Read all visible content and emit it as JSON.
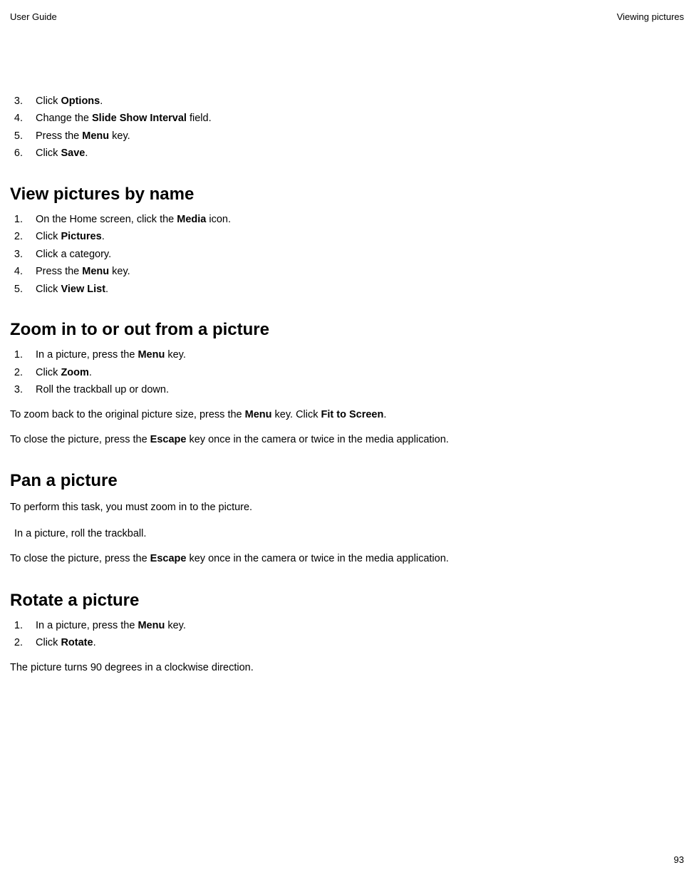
{
  "header": {
    "left": "User Guide",
    "right": "Viewing pictures"
  },
  "intro_list": [
    {
      "num": "3.",
      "pre": "Click ",
      "bold": "Options",
      "post": "."
    },
    {
      "num": "4.",
      "pre": "Change the ",
      "bold": "Slide Show Interval",
      "post": " field."
    },
    {
      "num": "5.",
      "pre": "Press the ",
      "bold": "Menu",
      "post": " key."
    },
    {
      "num": "6.",
      "pre": "Click ",
      "bold": "Save",
      "post": "."
    }
  ],
  "section1": {
    "title": "View pictures by name",
    "items": [
      {
        "num": "1.",
        "pre": "On the Home screen, click the ",
        "bold": "Media",
        "post": " icon."
      },
      {
        "num": "2.",
        "pre": "Click ",
        "bold": "Pictures",
        "post": "."
      },
      {
        "num": "3.",
        "pre": "Click a category.",
        "bold": "",
        "post": ""
      },
      {
        "num": "4.",
        "pre": "Press the ",
        "bold": "Menu",
        "post": " key."
      },
      {
        "num": "5.",
        "pre": "Click ",
        "bold": "View List",
        "post": "."
      }
    ]
  },
  "section2": {
    "title": "Zoom in to or out from a picture",
    "items": [
      {
        "num": "1.",
        "pre": "In a picture, press the ",
        "bold": "Menu",
        "post": " key."
      },
      {
        "num": "2.",
        "pre": "Click ",
        "bold": "Zoom",
        "post": "."
      },
      {
        "num": "3.",
        "pre": "Roll the trackball up or down.",
        "bold": "",
        "post": ""
      }
    ],
    "para1_pre": "To zoom back to the original picture size, press the ",
    "para1_b1": "Menu",
    "para1_mid": " key. Click ",
    "para1_b2": "Fit to Screen",
    "para1_post": ".",
    "para2_pre": "To close the picture, press the ",
    "para2_b1": "Escape",
    "para2_post": " key once in the camera or twice in the media application."
  },
  "section3": {
    "title": "Pan a picture",
    "para1": "To perform this task, you must zoom in to the picture.",
    "para2": "In a picture, roll the trackball.",
    "para3_pre": "To close the picture, press the ",
    "para3_b1": "Escape",
    "para3_post": " key once in the camera or twice in the media application."
  },
  "section4": {
    "title": "Rotate a picture",
    "items": [
      {
        "num": "1.",
        "pre": "In a picture, press the ",
        "bold": "Menu",
        "post": " key."
      },
      {
        "num": "2.",
        "pre": "Click ",
        "bold": "Rotate",
        "post": "."
      }
    ],
    "para1": "The picture turns 90 degrees in a clockwise direction."
  },
  "page_number": "93"
}
